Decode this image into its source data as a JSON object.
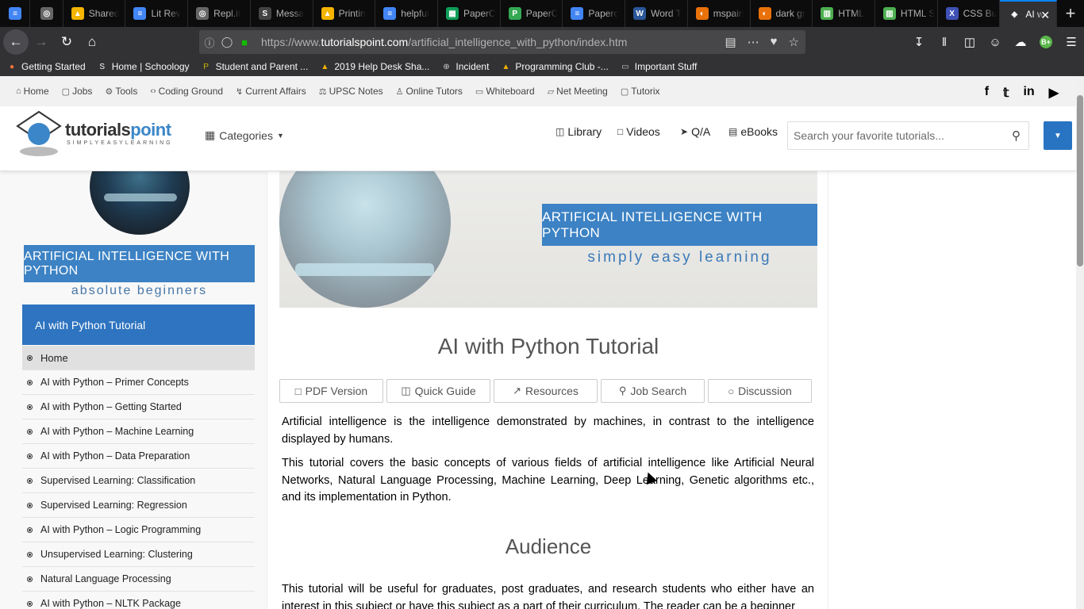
{
  "browser": {
    "tabs": [
      {
        "label": "",
        "icon": "docs-icon",
        "color": "#4285f4"
      },
      {
        "label": "",
        "icon": "replit-icon",
        "color": "#666666"
      },
      {
        "label": "Shared",
        "icon": "drive-icon",
        "color": "#f4b400"
      },
      {
        "label": "Lit Rev",
        "icon": "docs-icon",
        "color": "#4285f4"
      },
      {
        "label": "Repl.it",
        "icon": "replit-icon",
        "color": "#666666"
      },
      {
        "label": "Messa",
        "icon": "schoology-icon",
        "color": "#444444"
      },
      {
        "label": "Printin",
        "icon": "drive-icon",
        "color": "#f4b400"
      },
      {
        "label": "helpful",
        "icon": "docs-icon",
        "color": "#4285f4"
      },
      {
        "label": "PaperC",
        "icon": "sheets-icon",
        "color": "#0f9d58"
      },
      {
        "label": "PaperC",
        "icon": "paper-icon",
        "color": "#34a853"
      },
      {
        "label": "Paperc",
        "icon": "docs-icon",
        "color": "#4285f4"
      },
      {
        "label": "Word T",
        "icon": "word-icon",
        "color": "#2b579a"
      },
      {
        "label": "mspain",
        "icon": "mspaint-icon",
        "color": "#e8710a"
      },
      {
        "label": "dark gr",
        "icon": "dark-icon",
        "color": "#e8710a"
      },
      {
        "label": "HTML",
        "icon": "chart-icon",
        "color": "#4caf50"
      },
      {
        "label": "HTML S",
        "icon": "chart-icon",
        "color": "#4caf50"
      },
      {
        "label": "CSS Bu",
        "icon": "x-icon",
        "color": "#3f51b5"
      },
      {
        "label": "AI w",
        "icon": "tutorialspoint-icon",
        "color": "#ffffff",
        "active": true
      }
    ],
    "url_prefix": "https://www.",
    "url_domain": "tutorialspoint.com",
    "url_path": "/artificial_intelligence_with_python/index.htm",
    "bookmarks": [
      {
        "label": "Getting Started",
        "icon": "firefox-icon",
        "color": "#ff7139"
      },
      {
        "label": "Home | Schoology",
        "icon": "schoology-icon",
        "color": "#ffffff"
      },
      {
        "label": "Student and Parent ...",
        "icon": "p-icon",
        "color": "#c8b400"
      },
      {
        "label": "2019 Help Desk Sha...",
        "icon": "drive-icon",
        "color": "#f4b400"
      },
      {
        "label": "Incident",
        "icon": "globe-icon",
        "color": "#cccccc"
      },
      {
        "label": "Programming Club -...",
        "icon": "drive-icon",
        "color": "#f4b400"
      },
      {
        "label": "Important Stuff",
        "icon": "folder-icon",
        "color": "#cccccc"
      }
    ]
  },
  "topnav": {
    "items": [
      "Home",
      "Jobs",
      "Tools",
      "Coding Ground",
      "Current Affairs",
      "UPSC Notes",
      "Online Tutors",
      "Whiteboard",
      "Net Meeting",
      "Tutorix"
    ],
    "social": [
      "f",
      "t",
      "in",
      "yt"
    ]
  },
  "header": {
    "logo_main": "tutorials",
    "logo_accent": "point",
    "logo_tagline": "SIMPLYEASYLEARNING",
    "categories": "Categories",
    "links": [
      "Library",
      "Videos",
      "Q/A",
      "eBooks"
    ],
    "search_placeholder": "Search your favorite tutorials..."
  },
  "sidebar": {
    "banner_title": "ARTIFICIAL INTELLIGENCE WITH PYTHON",
    "banner_sub": "absolute beginners",
    "heading": "AI with Python Tutorial",
    "items": [
      "Home",
      "AI with Python – Primer Concepts",
      "AI with Python – Getting Started",
      "AI with Python – Machine Learning",
      "AI with Python – Data Preparation",
      "Supervised Learning: Classification",
      "Supervised Learning: Regression",
      "AI with Python – Logic Programming",
      "Unsupervised Learning: Clustering",
      "Natural Language Processing",
      "AI with Python – NLTK Package"
    ]
  },
  "content": {
    "banner_title": "ARTIFICIAL INTELLIGENCE WITH PYTHON",
    "banner_sub": "simply easy learning",
    "title": "AI with Python Tutorial",
    "buttons": [
      "PDF Version",
      "Quick Guide",
      "Resources",
      "Job Search",
      "Discussion"
    ],
    "para1": "Artificial intelligence is the intelligence demonstrated by machines, in contrast to the intelligence displayed by humans.",
    "para2": "This tutorial covers the basic concepts of various fields of artificial intelligence like Artificial Neural Networks, Natural Language Processing, Machine Learning, Deep Learning, Genetic algorithms etc., and its implementation in Python.",
    "section_title": "Audience",
    "para3": "This tutorial will be useful for graduates, post graduates, and research students who either have an interest in this subject or have this subject as a part of their curriculum. The reader can be a beginner"
  }
}
